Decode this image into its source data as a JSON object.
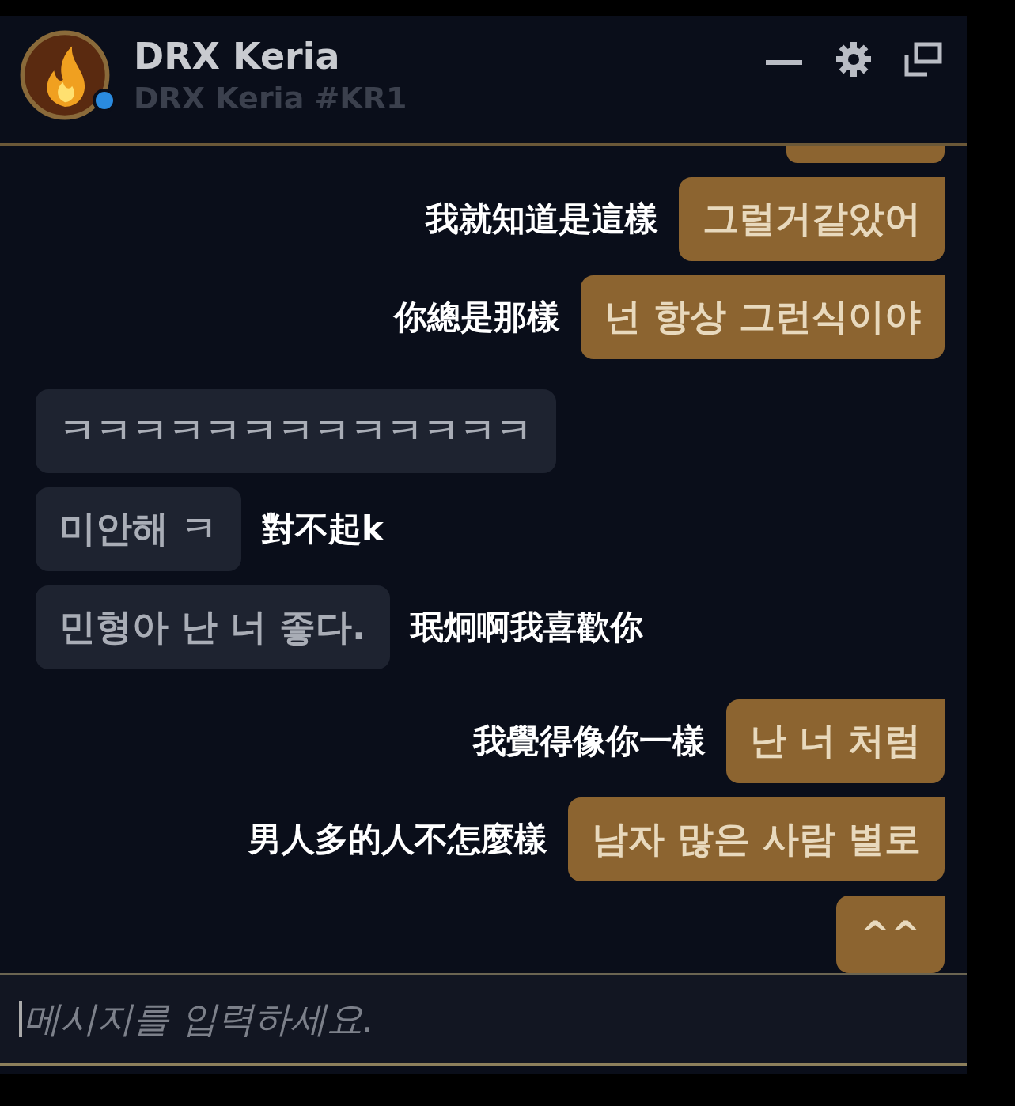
{
  "header": {
    "name": "DRX Keria",
    "tag": "DRX Keria #KR1",
    "online": true
  },
  "message_groups": [
    {
      "messages": [
        {
          "kind": "sent",
          "text": "그럴거같았어",
          "caption": "我就知道是這樣"
        },
        {
          "kind": "sent",
          "text": "넌 항상 그런식이야",
          "caption": "你總是那樣"
        }
      ]
    },
    {
      "messages": [
        {
          "kind": "received",
          "text": "ㅋㅋㅋㅋㅋㅋㅋㅋㅋㅋㅋㅋㅋ"
        },
        {
          "kind": "received",
          "text": "미안해 ㅋ",
          "caption": "對不起k"
        },
        {
          "kind": "received",
          "text": "민형아 난 너 좋다.",
          "caption": "珉炯啊我喜歡你"
        }
      ]
    },
    {
      "messages": [
        {
          "kind": "sent",
          "text": "난 너 처럼",
          "caption": "我覺得像你一樣"
        },
        {
          "kind": "sent",
          "text": "남자 많은 사람 별로",
          "caption": "男人多的人不怎麼樣"
        },
        {
          "kind": "sent",
          "text": "^^"
        }
      ]
    }
  ],
  "input": {
    "placeholder": "메시지를 입력하세요."
  }
}
